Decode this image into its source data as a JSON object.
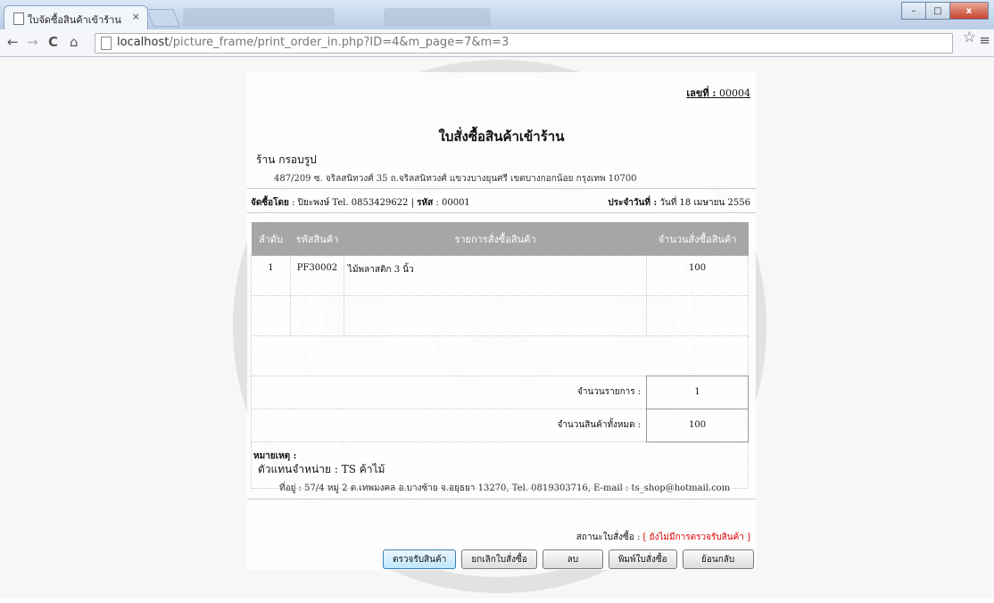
{
  "browser": {
    "tab_title": "ใบจัดซื้อสินค้าเข้าร้าน",
    "tab_close": "×",
    "url_host": "localhost",
    "url_path": "/picture_frame/print_order_in.php?ID=4&m_page=7&m=3",
    "win_min": "–",
    "win_max": "□",
    "win_close": "x"
  },
  "icons": {
    "back": "←",
    "forward": "→",
    "reload": "C",
    "home": "⌂",
    "star": "☆",
    "menu": "≡"
  },
  "doc": {
    "number_label": "เลขที่ :",
    "number_value": "00004",
    "title": "ใบสั่งซื้อสินค้าเข้าร้าน",
    "shop_name": "ร้าน กรอบรูป",
    "shop_address": "487/209 ซ. จริลสนิทวงศ์ 35 ถ.จริลสนิทวงศ์ แขวงบางยุนศรี เขตบางกอกน้อย กรุงเทพ 10700",
    "order_by_label": "จัดซื้อโดย",
    "order_by_value": ": ปิยะพงษ์ Tel. 0853429622 |",
    "code_label": "รหัส",
    "code_value": ": 00001",
    "date_label": "ประจำวันที่ :",
    "date_value": "วันที่ 18 เมษายน 2556",
    "table_headers": [
      "ลำดับ",
      "รหัสสินค้า",
      "รายการสั่งซื้อสินค้า",
      "จำนวนสั่งซื้อสินค้า"
    ],
    "rows": [
      {
        "no": "1",
        "code": "PF30002",
        "name": "ไม้พลาสติก 3 นิ้ว",
        "qty": "100"
      }
    ],
    "total_items_label": "จำนวนรายการ :",
    "total_items_value": "1",
    "total_qty_label": "จำนวนสินค้าทั้งหมด :",
    "total_qty_value": "100",
    "note_label": "หมายเหตุ :",
    "agent": "ตัวแทนจำหน่าย : TS ค้าไม้",
    "agent_address": "ที่อยู่ : 57/4 หมู่ 2 ต.เทพมงคล อ.บางซ้าย จ.อยุธยา 13270, Tel. 0819303716, E-mail : ts_shop@hotmail.com",
    "status_label": "สถานะใบสั่งซื้อ :",
    "status_value": "[ ยังไม่มีการตรวจรับสินค้า ]"
  },
  "buttons": {
    "receive": "ตรวจรับสินค้า",
    "cancel": "ยกเลิกใบสั่งซื้อ",
    "delete": "ลบ",
    "print": "พิมพ์ใบสั่งซื้อ",
    "back": "ย้อนกลับ"
  }
}
